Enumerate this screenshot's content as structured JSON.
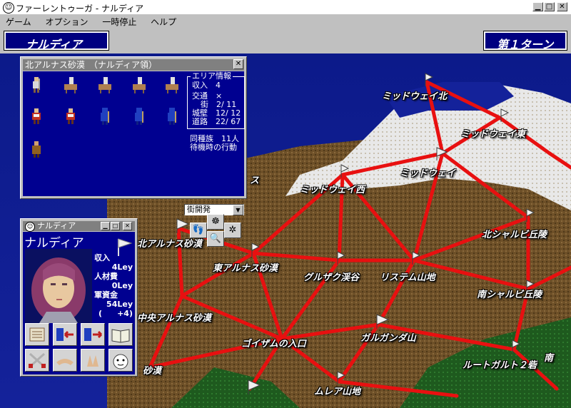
{
  "window": {
    "title": "ファーレントゥーガ - ナルディア"
  },
  "menu": [
    "ゲーム",
    "オプション",
    "一時停止",
    "ヘルプ"
  ],
  "header": {
    "nation": "ナルディア",
    "turn": "第１ターン"
  },
  "area_window": {
    "title": "北アルナス砂漠　（ナルディア領）",
    "info_title": "エリア情報",
    "income_label": "収入",
    "income_value": "4",
    "traffic_label": "交通",
    "traffic_value": "×",
    "town_label": "街",
    "town_value": "2/ 11",
    "wall_label": "城壁",
    "wall_value": "12/ 12",
    "road_label": "道路",
    "road_value": "22/ 67",
    "tribe_label": "同種族",
    "tribe_value": "11人",
    "standby_label": "待機時の行動",
    "standby_select": "街開発"
  },
  "char_window": {
    "title": "ナルディア",
    "name": "ナルディア",
    "income_label": "収入",
    "income_value": "4Ley",
    "personnel_label": "人材費",
    "personnel_value": "0Ley",
    "funds_label": "軍資金",
    "funds_value": "54Ley",
    "funds_delta_open": "(",
    "funds_delta": "+4)"
  },
  "map_locations": [
    "ミッドウェイ北",
    "ミッドウェイ東",
    "ミッドウェイ",
    "ミッドウェイ西",
    "北アルナス砂漠",
    "東アルナス砂漠",
    "グルザク渓谷",
    "リステム山地",
    "北シャルビ丘陵",
    "南シャルビ丘陵",
    "中央アルナス砂漠",
    "ゴイザムの入口",
    "ガルガンダ山",
    "ルートガルト２砦",
    "ムレア山地",
    "砂漠",
    "ス",
    "南"
  ],
  "colors": {
    "navy": "#000080",
    "road": "#e81010",
    "sea": "#10209a",
    "desert": "#7a5a30"
  }
}
